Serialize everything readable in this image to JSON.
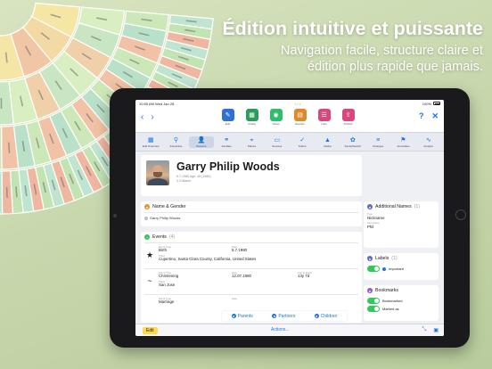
{
  "marketing": {
    "headline": "Édition intuitive et puissante",
    "subline_1": "Navigation facile, structure claire et",
    "subline_2": "édition plus rapide que jamais."
  },
  "statusbar": {
    "time": "10:55 AM",
    "date": "Wed Jan 28",
    "battery": "100%"
  },
  "toolbar": {
    "items": [
      {
        "label": "Edit",
        "icon": "pencil-icon",
        "color": "#2f6fd6"
      },
      {
        "label": "Charts",
        "icon": "chart-icon",
        "color": "#2c9c5a"
      },
      {
        "label": "Views",
        "icon": "eye-icon",
        "color": "#2ebd6a"
      },
      {
        "label": "Reports",
        "icon": "report-icon",
        "color": "#e0872b"
      },
      {
        "label": "Lists",
        "icon": "list-icon",
        "color": "#d9477f"
      },
      {
        "label": "Publish",
        "icon": "share-icon",
        "color": "#d9477f"
      }
    ],
    "help": "?",
    "close": "✕"
  },
  "iconbar": [
    {
      "label": "Edit Overview",
      "icon": "grid-icon"
    },
    {
      "label": "Interactive",
      "icon": "tree-icon"
    },
    {
      "label": "Persons",
      "icon": "person-icon",
      "active": true
    },
    {
      "label": "Families",
      "icon": "family-icon"
    },
    {
      "label": "Places",
      "icon": "pin-icon"
    },
    {
      "label": "Sources",
      "icon": "book-icon"
    },
    {
      "label": "ToDo's",
      "icon": "check-icon"
    },
    {
      "label": "Media",
      "icon": "photo-icon"
    },
    {
      "label": "FamilySearch",
      "icon": "familysearch-icon"
    },
    {
      "label": "Changes",
      "icon": "changes-icon"
    },
    {
      "label": "Anomalies",
      "icon": "flag-icon"
    },
    {
      "label": "Analyze",
      "icon": "analyze-icon"
    }
  ],
  "person": {
    "name": "Garry Philip Woods",
    "meta_1": "5.7.1980 Age: 45 (1980)",
    "meta_2": "3 Children"
  },
  "name_gender": {
    "title": "Name & Gender",
    "value": "Garry Philip Woods"
  },
  "events": {
    "title": "Events",
    "count": "(4)",
    "items": [
      {
        "symbol": "★",
        "type_label": "Event Type",
        "type": "Birth",
        "date_label": "Date",
        "date": "5.7.1980",
        "place_label": "Place",
        "place": "Cupertino, Santa Clara County, California, United States",
        "age_label": "",
        "age": ""
      },
      {
        "symbol": "~",
        "type_label": "Event Type",
        "type": "Christening",
        "date_label": "Date",
        "date": "12.07.1980",
        "place_label": "Place",
        "place": "San Jose",
        "age_label": "Age at Event",
        "age": "13y 7d"
      },
      {
        "symbol": "",
        "type_label": "Event Type",
        "type": "Marriage",
        "date_label": "Date",
        "date": "",
        "place_label": "",
        "place": "",
        "age_label": "",
        "age": ""
      }
    ]
  },
  "additional_names": {
    "title": "Additional Names",
    "count": "(1)",
    "type_label": "Type",
    "type": "Nickname",
    "first_label": "First Name",
    "first": "Phil"
  },
  "labels": {
    "title": "Labels",
    "count": "(1)",
    "label": "Important"
  },
  "bookmarks": {
    "title": "Bookmarks",
    "row_1": "Bookmarked",
    "row_2": "Marked as"
  },
  "relations": {
    "parents": "Parents",
    "partners": "Partners",
    "children": "Children"
  },
  "bottombar": {
    "edit": "Edit",
    "actions": "Actions..."
  },
  "colors": {
    "accent": "#1a73e8",
    "green": "#34c759",
    "edit_yellow": "#ffd84d"
  }
}
